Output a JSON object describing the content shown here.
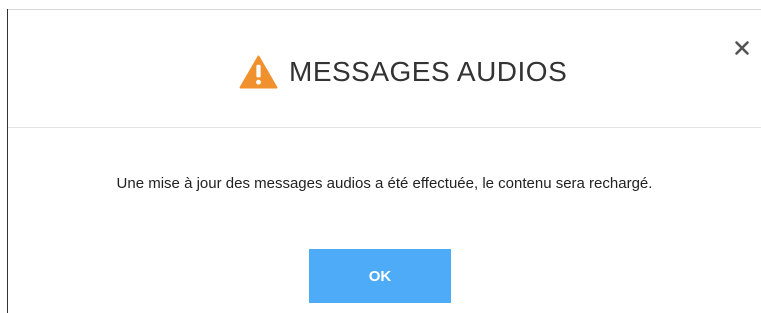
{
  "dialog": {
    "title": "MESSAGES AUDIOS",
    "title_icon": "warning-icon",
    "close_icon": "close-icon",
    "message": "Une mise à jour des messages audios a été effectuée, le contenu sera rechargé.",
    "ok_label": "OK"
  },
  "colors": {
    "warning": "#f0912d",
    "button_bg": "#4dabf7",
    "button_text": "#ffffff",
    "title_text": "#333333",
    "close_icon": "#555555"
  }
}
